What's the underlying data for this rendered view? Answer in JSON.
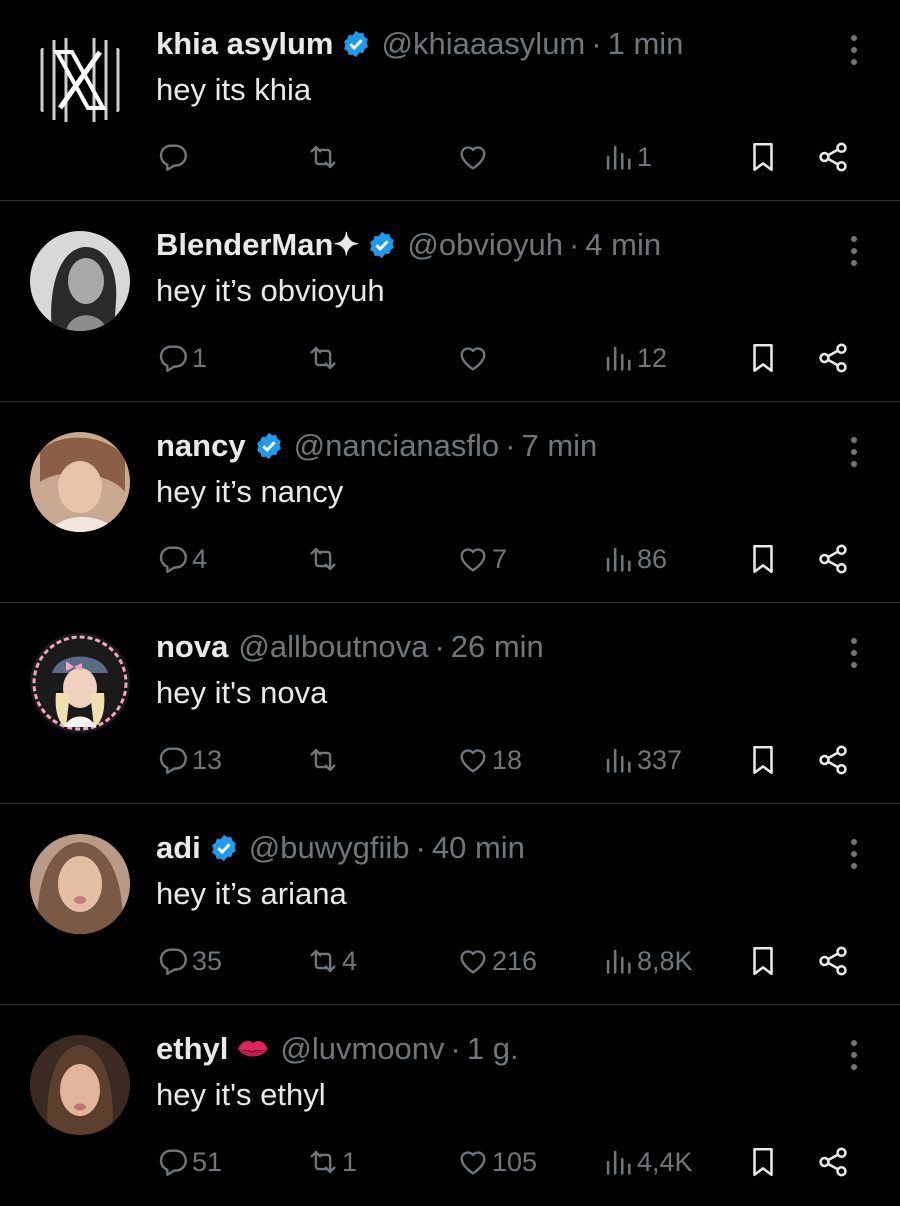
{
  "tweets": [
    {
      "name": "khia asylum",
      "verified": true,
      "handle": "@khiaaasylum",
      "separator": "·",
      "time": "1 min",
      "text": "hey its khia",
      "replies": "",
      "reposts": "",
      "likes": "",
      "views": "1",
      "avatar_icon": "x-logo-avatar"
    },
    {
      "name": "BlenderMan✦",
      "verified": true,
      "handle": "@obvioyuh",
      "separator": "·",
      "time": "4 min",
      "text": "hey it’s obvioyuh",
      "replies": "1",
      "reposts": "",
      "likes": "",
      "views": "12",
      "avatar_icon": "profile-photo"
    },
    {
      "name": "nancy",
      "verified": true,
      "handle": "@nancianasflo",
      "separator": "·",
      "time": "7 min",
      "text": "hey it’s nancy",
      "replies": "4",
      "reposts": "",
      "likes": "7",
      "views": "86",
      "avatar_icon": "profile-photo"
    },
    {
      "name": "nova",
      "verified": false,
      "handle": "@allboutnova",
      "separator": "·",
      "time": "26 min",
      "text": "hey it's nova",
      "replies": "13",
      "reposts": "",
      "likes": "18",
      "views": "337",
      "avatar_icon": "profile-photo"
    },
    {
      "name": "adi",
      "verified": true,
      "handle": "@buwygfiib",
      "separator": "·",
      "time": "40 min",
      "text": "hey it’s ariana",
      "replies": "35",
      "reposts": "4",
      "likes": "216",
      "views": "8,8K",
      "avatar_icon": "profile-photo"
    },
    {
      "name": "ethyl",
      "verified": false,
      "name_emoji": "kiss-lips-emoji",
      "handle": "@luvmoonv",
      "separator": "·",
      "time": "1 g.",
      "text": "hey it's ethyl",
      "replies": "51",
      "reposts": "1",
      "likes": "105",
      "views": "4,4K",
      "avatar_icon": "profile-photo"
    }
  ],
  "colors": {
    "background": "#000000",
    "text": "#e7e9ea",
    "muted": "#71767b",
    "verified": "#1d9bf0",
    "divider": "#2f3336",
    "lips": "#e0245e"
  }
}
